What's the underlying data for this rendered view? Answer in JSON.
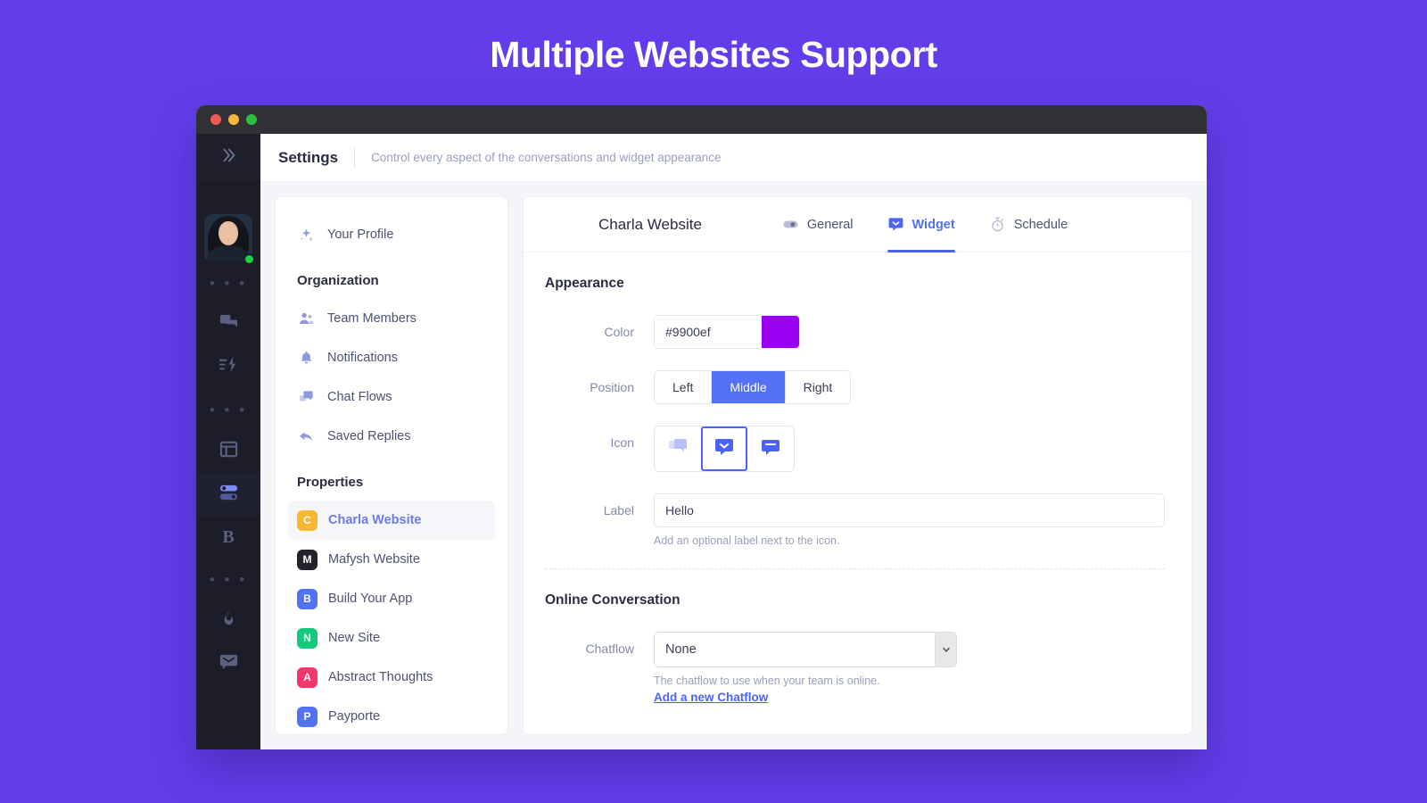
{
  "banner": {
    "title": "Multiple Websites Support",
    "background_color": "#643deb"
  },
  "window": {
    "traffic_lights": [
      "close",
      "minimize",
      "maximize"
    ]
  },
  "rail": {
    "collapse_icon": "chevrons-right-icon",
    "status": "online",
    "items": [
      {
        "name": "separator-dots",
        "icon": "dots-icon",
        "type": "separator",
        "label": "• • •"
      },
      {
        "name": "conversations",
        "icon": "chat-bubbles-icon",
        "type": "icon",
        "active": false
      },
      {
        "name": "automations",
        "icon": "lightning-lines-icon",
        "type": "icon",
        "active": false
      },
      {
        "name": "separator-dots",
        "icon": "dots-icon",
        "type": "separator",
        "label": "• • •"
      },
      {
        "name": "dashboard",
        "icon": "layout-icon",
        "type": "icon",
        "active": false
      },
      {
        "name": "settings",
        "icon": "toggles-icon",
        "type": "icon",
        "active": true
      },
      {
        "name": "brand",
        "icon": "letter-b-icon",
        "type": "letter",
        "label": "B"
      },
      {
        "name": "separator-dots",
        "icon": "dots-icon",
        "type": "separator",
        "label": "• • •"
      },
      {
        "name": "trending",
        "icon": "flame-icon",
        "type": "icon",
        "active": false
      },
      {
        "name": "inbox",
        "icon": "envelope-icon",
        "type": "icon",
        "active": false
      }
    ]
  },
  "topbar": {
    "title": "Settings",
    "subtitle": "Control every aspect of the conversations and widget appearance"
  },
  "settings_menu": {
    "profile": {
      "label": "Your Profile",
      "icon": "sparkle-icon"
    },
    "organization_heading": "Organization",
    "organization_items": [
      {
        "label": "Team Members",
        "icon": "users-icon"
      },
      {
        "label": "Notifications",
        "icon": "bell-icon"
      },
      {
        "label": "Chat Flows",
        "icon": "chat-flow-icon"
      },
      {
        "label": "Saved Replies",
        "icon": "reply-arrow-icon"
      }
    ],
    "properties_heading": "Properties",
    "properties_items": [
      {
        "label": "Charla Website",
        "initial": "C",
        "color": "#f7b733",
        "selected": true
      },
      {
        "label": "Mafysh Website",
        "initial": "M",
        "color": "#23232e",
        "selected": false
      },
      {
        "label": "Build Your App",
        "initial": "B",
        "color": "#5271f5",
        "selected": false
      },
      {
        "label": "New Site",
        "initial": "N",
        "color": "#13c97b",
        "selected": false
      },
      {
        "label": "Abstract Thoughts",
        "initial": "A",
        "color": "#f5366b",
        "selected": false
      },
      {
        "label": "Payporte",
        "initial": "P",
        "color": "#5271f5",
        "selected": false
      }
    ]
  },
  "detail": {
    "title": "Charla Website",
    "tabs": [
      {
        "label": "General",
        "icon": "toggle-icon",
        "active": false
      },
      {
        "label": "Widget",
        "icon": "chat-bubble-icon",
        "active": true
      },
      {
        "label": "Schedule",
        "icon": "stopwatch-icon",
        "active": false
      }
    ],
    "appearance": {
      "heading": "Appearance",
      "color": {
        "label": "Color",
        "value": "#9900ef",
        "swatch_color": "#9900ef"
      },
      "position": {
        "label": "Position",
        "options": [
          "Left",
          "Middle",
          "Right"
        ],
        "selected": "Middle"
      },
      "icon": {
        "label": "Icon",
        "options": [
          "chat-bubbles-icon",
          "chat-smile-icon",
          "chat-lines-icon"
        ],
        "selected_index": 1
      },
      "widget_label": {
        "label": "Label",
        "value": "Hello",
        "placeholder": "Hello",
        "hint": "Add an optional label next to the icon."
      }
    },
    "online_conversation": {
      "heading": "Online Conversation",
      "chatflow": {
        "label": "Chatflow",
        "value": "None",
        "options": [
          "None"
        ],
        "hint": "The chatflow to use when your team is online.",
        "link": "Add a new Chatflow"
      }
    },
    "accent_color": "#4c63f5"
  }
}
